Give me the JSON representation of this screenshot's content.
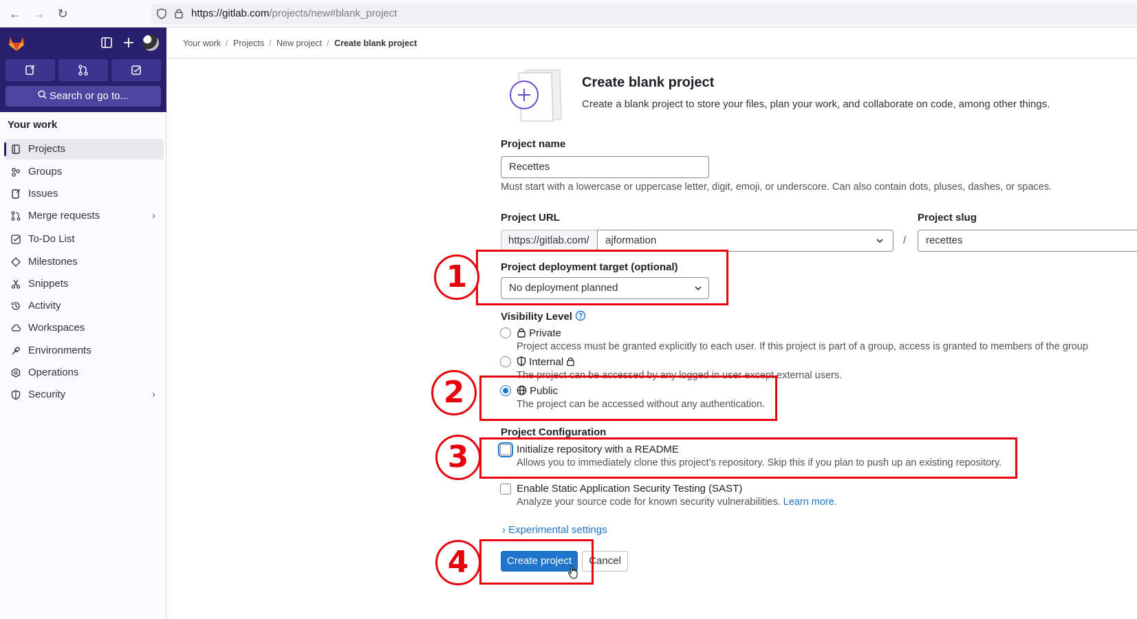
{
  "browser": {
    "url_host": "https://gitlab.com",
    "url_path": "/projects/new#blank_project"
  },
  "sidebar": {
    "search_label": "Search or go to...",
    "heading": "Your work",
    "items": [
      {
        "label": "Projects",
        "icon": "project-icon",
        "active": true
      },
      {
        "label": "Groups",
        "icon": "group-icon"
      },
      {
        "label": "Issues",
        "icon": "issues-icon"
      },
      {
        "label": "Merge requests",
        "icon": "merge-request-icon",
        "chevron": true
      },
      {
        "label": "To-Do List",
        "icon": "todo-icon"
      },
      {
        "label": "Milestones",
        "icon": "milestone-icon"
      },
      {
        "label": "Snippets",
        "icon": "snippet-icon"
      },
      {
        "label": "Activity",
        "icon": "history-icon"
      },
      {
        "label": "Workspaces",
        "icon": "cloud-icon"
      },
      {
        "label": "Environments",
        "icon": "environment-icon"
      },
      {
        "label": "Operations",
        "icon": "cloud-gear-icon"
      },
      {
        "label": "Security",
        "icon": "shield-icon",
        "chevron": true
      }
    ]
  },
  "breadcrumb": {
    "items": [
      "Your work",
      "Projects",
      "New project"
    ],
    "current": "Create blank project"
  },
  "page": {
    "title": "Create blank project",
    "description": "Create a blank project to store your files, plan your work, and collaborate on code, among other things."
  },
  "form": {
    "project_name_label": "Project name",
    "project_name_value": "Recettes",
    "project_name_help": "Must start with a lowercase or uppercase letter, digit, emoji, or underscore. Can also contain dots, pluses, dashes, or spaces.",
    "project_url_label": "Project URL",
    "project_url_prefix": "https://gitlab.com/",
    "namespace_value": "ajformation",
    "url_separator": "/",
    "project_slug_label": "Project slug",
    "project_slug_value": "recettes",
    "deployment_label": "Project deployment target (optional)",
    "deployment_value": "No deployment planned",
    "visibility_label": "Visibility Level",
    "visibility_options": [
      {
        "label": "Private",
        "desc": "Project access must be granted explicitly to each user. If this project is part of a group, access is granted to members of the group",
        "selected": false
      },
      {
        "label": "Internal",
        "desc": "The project can be accessed by any logged in user except external users.",
        "selected": false
      },
      {
        "label": "Public",
        "desc": "The project can be accessed without any authentication.",
        "selected": true
      }
    ],
    "config_label": "Project Configuration",
    "readme_label": "Initialize repository with a README",
    "readme_desc": "Allows you to immediately clone this project’s repository. Skip this if you plan to push up an existing repository.",
    "readme_checked": false,
    "sast_label": "Enable Static Application Security Testing (SAST)",
    "sast_desc": "Analyze your source code for known security vulnerabilities.",
    "sast_link": "Learn more.",
    "sast_checked": false,
    "experimental_label": "Experimental settings",
    "create_button": "Create project",
    "cancel_button": "Cancel"
  },
  "annotations": {
    "color": "#e8000b",
    "steps": [
      "1",
      "2",
      "3",
      "4"
    ]
  }
}
